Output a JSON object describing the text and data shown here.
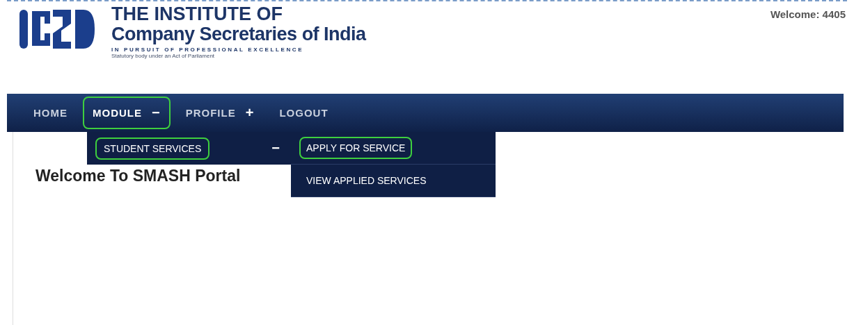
{
  "header": {
    "logo_title": "THE INSTITUTE OF",
    "logo_subtitle": "Company Secretaries of India",
    "tagline": "IN PURSUIT OF PROFESSIONAL EXCELLENCE",
    "statutory_note": "Statutory body under an Act of Parliament",
    "welcome": "Welcome: 4405"
  },
  "nav": [
    {
      "label": "HOME",
      "highlighted": false
    },
    {
      "label": "MODULE",
      "sign": "−",
      "highlighted": true,
      "expanded": true
    },
    {
      "label": "PROFILE",
      "sign": "+",
      "highlighted": false
    },
    {
      "label": "LOGOUT",
      "highlighted": false
    }
  ],
  "submenu": [
    {
      "label": "STUDENT SERVICES",
      "sign": "−",
      "highlighted": true,
      "children": [
        {
          "label": "APPLY FOR SERVICE",
          "highlighted": true
        },
        {
          "label": "VIEW APPLIED SERVICES",
          "highlighted": false
        }
      ]
    }
  ],
  "heading": "Welcome To SMASH Portal"
}
